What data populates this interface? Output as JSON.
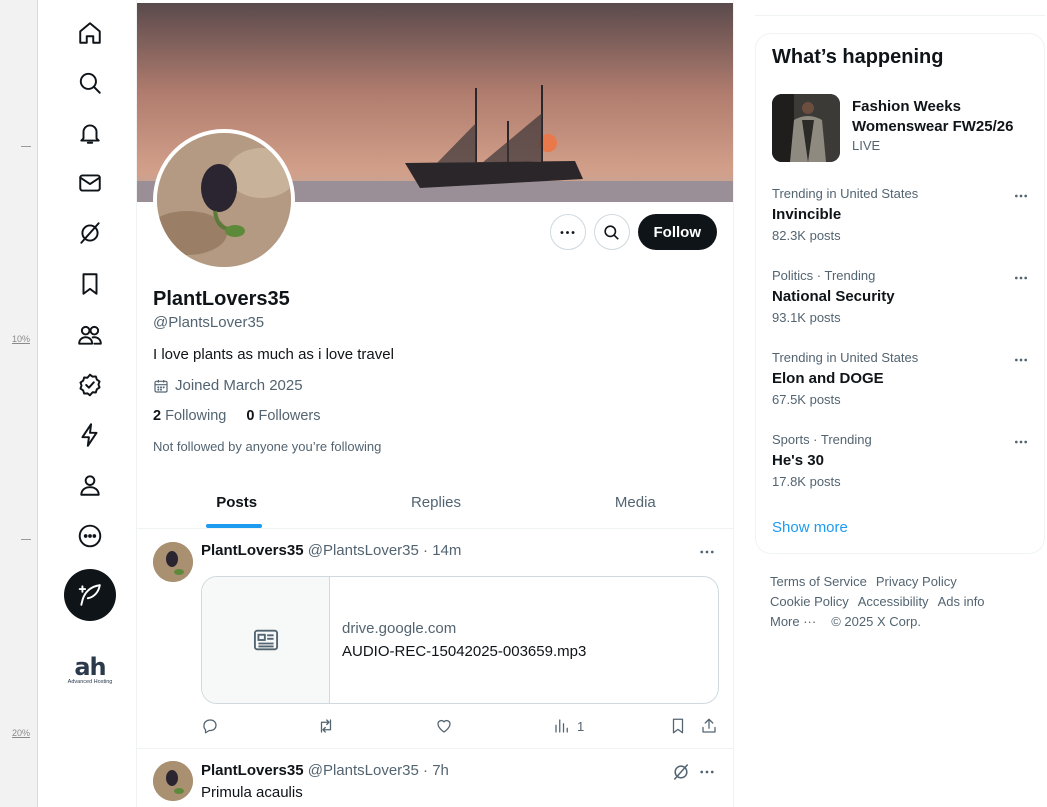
{
  "ruler": {
    "marks": [
      "10%",
      "20%"
    ]
  },
  "nav": {
    "items": [
      "home-icon",
      "explore-icon",
      "notifications-icon",
      "messages-icon",
      "grok-icon",
      "bookmarks-icon",
      "communities-icon",
      "verified-icon",
      "lightning-icon",
      "profile-icon",
      "more-icon"
    ],
    "post_button": "compose-icon",
    "brand": {
      "logo": "ah",
      "subtitle": "Advanced Hosting"
    }
  },
  "profile": {
    "name": "PlantLovers35",
    "handle": "@PlantsLover35",
    "bio": "I love plants as much as i love travel",
    "joined": "Joined March 2025",
    "following_count": "2",
    "following_label": "Following",
    "followers_count": "0",
    "followers_label": "Followers",
    "not_followed": "Not followed by anyone you’re following",
    "follow_label": "Follow"
  },
  "tabs": [
    {
      "label": "Posts",
      "active": true
    },
    {
      "label": "Replies",
      "active": false
    },
    {
      "label": "Media",
      "active": false
    }
  ],
  "tweets": [
    {
      "name": "PlantLovers35",
      "handle": "@PlantsLover35",
      "time": "14m",
      "card_domain": "drive.google.com",
      "card_title": "AUDIO-REC-15042025-003659.mp3",
      "views": "1"
    },
    {
      "name": "PlantLovers35",
      "handle": "@PlantsLover35",
      "time": "7h",
      "text": "Primula acaulis"
    }
  ],
  "sidebar": {
    "title": "What’s happening",
    "event": {
      "title": "Fashion Weeks Womenswear FW25/26",
      "status": "LIVE"
    },
    "trends": [
      {
        "context": "Trending in United States",
        "name": "Invincible",
        "count": "82.3K posts"
      },
      {
        "context": "Politics · Trending",
        "name": "National Security",
        "count": "93.1K posts"
      },
      {
        "context": "Trending in United States",
        "name": "Elon and DOGE",
        "count": "67.5K posts"
      },
      {
        "context": "Sports · Trending",
        "name": "He's 30",
        "count": "17.8K posts"
      }
    ],
    "show_more": "Show more"
  },
  "footer": {
    "links": [
      "Terms of Service",
      "Privacy Policy",
      "Cookie Policy",
      "Accessibility",
      "Ads info",
      "More ···"
    ],
    "copyright": "© 2025 X Corp."
  },
  "colors": {
    "accent": "#1d9bf0",
    "text": "#0f1419",
    "muted": "#536471",
    "border": "#eff3f4"
  }
}
